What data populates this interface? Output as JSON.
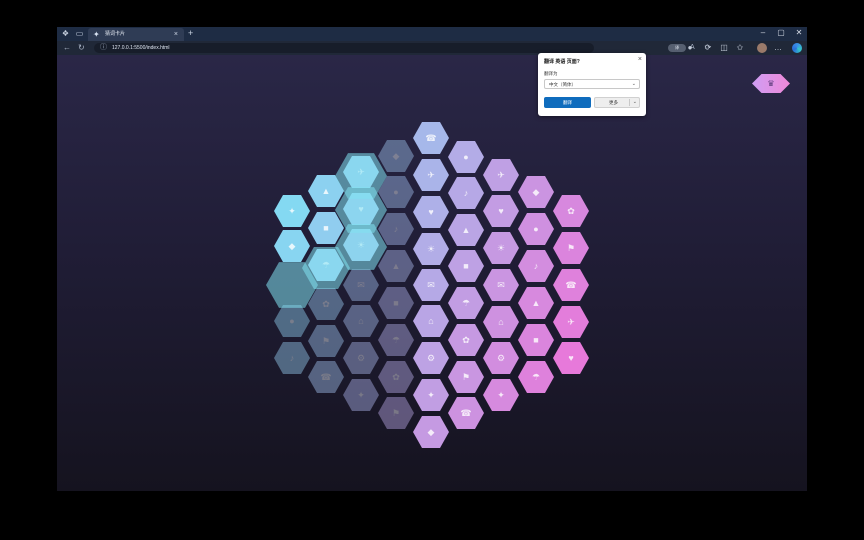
{
  "browser": {
    "tab": {
      "title": "猜词卡片",
      "favicon": "spark-icon",
      "close": "×"
    },
    "new_tab": "+",
    "window_controls": {
      "minimize": "–",
      "maximize": "▢",
      "close": "✕"
    },
    "url": "127.0.0.1:5500/index.html",
    "translate_badge": "译"
  },
  "translate_popup": {
    "title": "翻译 英语 页面?",
    "close": "×",
    "label": "翻译为",
    "language": "中文（简体）",
    "translate_button": "翻译",
    "more_button": "更多"
  },
  "floating_button_icon": "crown-icon"
}
